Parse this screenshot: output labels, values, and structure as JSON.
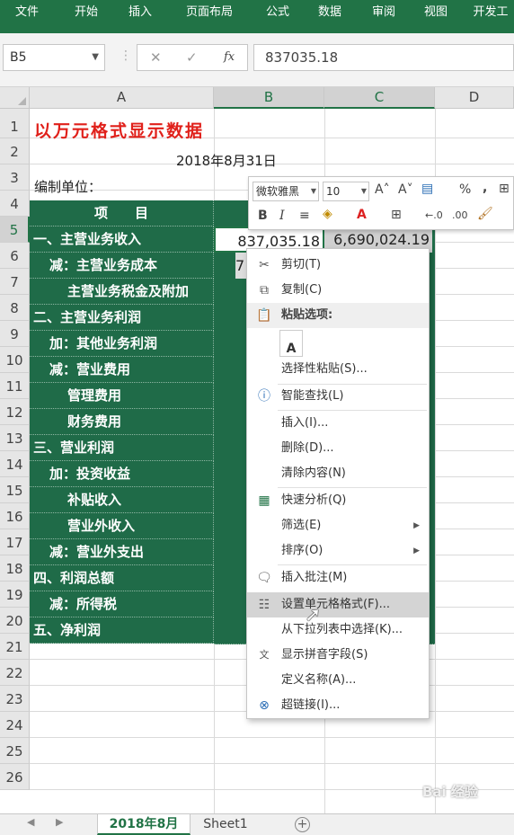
{
  "ribbon": {
    "tabs": [
      "文件",
      "开始",
      "插入",
      "页面布局",
      "公式",
      "数据",
      "审阅",
      "视图",
      "开发工"
    ]
  },
  "formula_bar": {
    "name_box": "B5",
    "cancel_icon": "✕",
    "enter_icon": "✓",
    "fx_label": "fx",
    "value": "837035.18"
  },
  "columns": [
    "A",
    "B",
    "C",
    "D"
  ],
  "rows": [
    "1",
    "2",
    "3",
    "4",
    "5",
    "6",
    "7",
    "8",
    "9",
    "10",
    "11",
    "12",
    "13",
    "14",
    "15",
    "16",
    "17",
    "18",
    "19",
    "20",
    "21",
    "22",
    "23",
    "24",
    "25",
    "26"
  ],
  "sheet": {
    "title": "以万元格式显示数据",
    "date": "2018年8月31日",
    "unit_label": "编制单位：",
    "header_item": "项　　目",
    "items": [
      "一、主营业务收入",
      "减：主营业务成本",
      "主营业务税金及附加",
      "二、主营业务利润",
      "加：其他业务利润",
      "减：营业费用",
      "管理费用",
      "财务费用",
      "三、营业利润",
      "加：投资收益",
      "补贴收入",
      "营业外收入",
      "减：营业外支出",
      "四、利润总额",
      "减：所得税",
      "五、净利润"
    ],
    "b5": "837,035.18",
    "c5": "6,690,024.19",
    "b6_partial": "7"
  },
  "mini_toolbar": {
    "font": "微软雅黑",
    "size": "10",
    "grow_font": "A˄",
    "shrink_font": "A˅",
    "percent": "%",
    "comma": ",",
    "bold": "B",
    "italic": "I",
    "align": "≡",
    "font_color_letter": "A",
    "inc_decimal": "←.0",
    "dec_decimal": ".00"
  },
  "context_menu": {
    "items": [
      {
        "label": "剪切(T)",
        "icon": "scissors-icon"
      },
      {
        "label": "复制(C)",
        "icon": "copy-icon"
      },
      {
        "label": "粘贴选项:",
        "icon": "paste-icon"
      },
      {
        "label": "选择性粘贴(S)...",
        "icon": ""
      },
      {
        "label": "智能查找(L)",
        "icon": "smart-lookup-icon"
      },
      {
        "label": "插入(I)...",
        "icon": ""
      },
      {
        "label": "删除(D)...",
        "icon": ""
      },
      {
        "label": "清除内容(N)",
        "icon": ""
      },
      {
        "label": "快速分析(Q)",
        "icon": "quick-analysis-icon"
      },
      {
        "label": "筛选(E)",
        "icon": ""
      },
      {
        "label": "排序(O)",
        "icon": ""
      },
      {
        "label": "插入批注(M)",
        "icon": "comment-icon"
      },
      {
        "label": "设置单元格格式(F)...",
        "icon": "format-cells-icon"
      },
      {
        "label": "从下拉列表中选择(K)...",
        "icon": ""
      },
      {
        "label": "显示拼音字段(S)",
        "icon": "phonetic-icon"
      },
      {
        "label": "定义名称(A)...",
        "icon": ""
      },
      {
        "label": "超链接(I)...",
        "icon": "hyperlink-icon"
      }
    ],
    "paste_option_letter": "A"
  },
  "sheet_tabs": [
    "2018年8月",
    "Sheet1"
  ],
  "watermark": "Bai 经验",
  "colors": {
    "ribbon": "#217346",
    "table_fill": "#1f6b48",
    "title_red": "#e0201a"
  }
}
